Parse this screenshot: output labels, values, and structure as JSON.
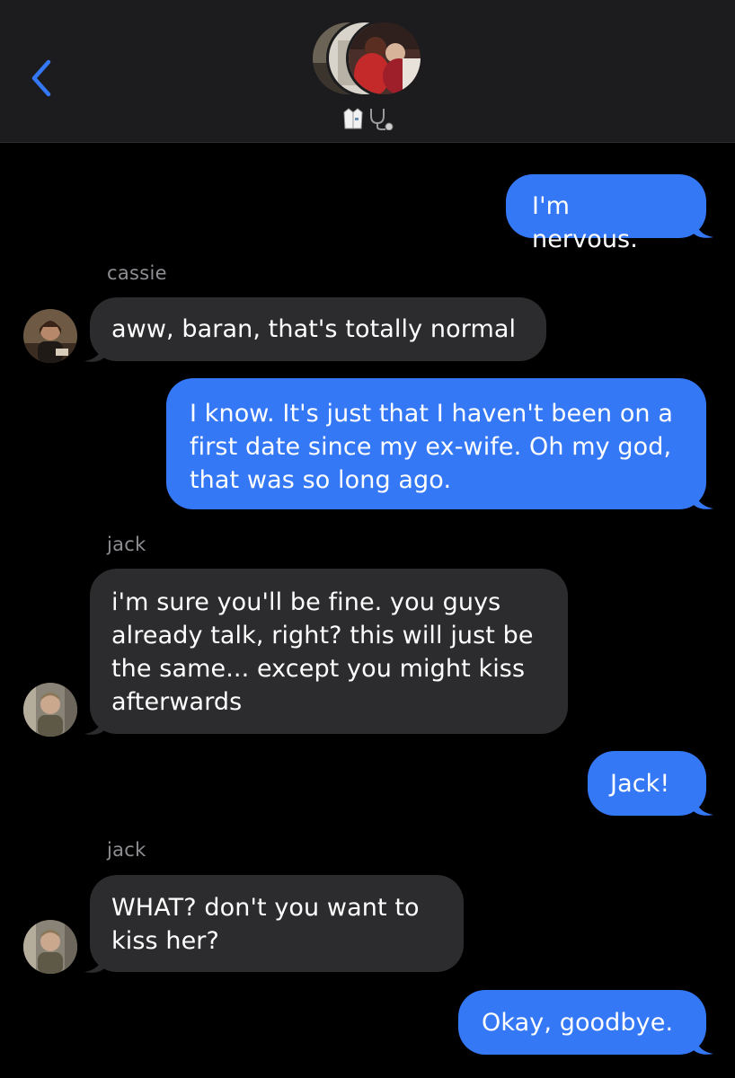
{
  "header": {
    "group_icons": [
      "person-icon",
      "lab-coat-icon",
      "stethoscope-icon"
    ],
    "accent_color": "#3478f6"
  },
  "messages": [
    {
      "sender": "me",
      "text": "I'm nervous."
    },
    {
      "sender": "cassie",
      "text": "aww, baran, that's totally normal"
    },
    {
      "sender": "me",
      "text": "I know. It's just that I haven't been on a first date since my ex-wife. Oh my god, that was so long ago."
    },
    {
      "sender": "jack",
      "text": "i'm sure you'll be fine. you guys already talk, right? this will just be the same... except you might kiss afterwards"
    },
    {
      "sender": "me",
      "text": "Jack!"
    },
    {
      "sender": "jack",
      "text": "WHAT? don't you want to kiss her?"
    },
    {
      "sender": "me",
      "text": "Okay, goodbye."
    }
  ],
  "colors": {
    "outgoing_bubble": "#3478f6",
    "incoming_bubble": "#2c2c2e",
    "background": "#000000",
    "header_bg": "#1c1c1e"
  }
}
